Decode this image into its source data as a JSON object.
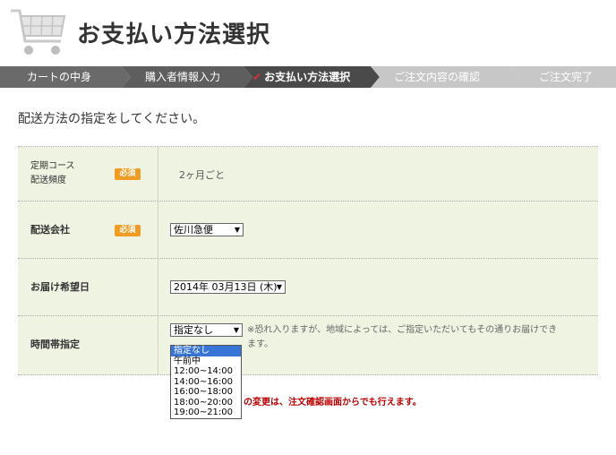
{
  "header": {
    "title": "お支払い方法選択",
    "cart_icon": "shopping-cart-icon"
  },
  "steps": [
    {
      "label": "カートの中身",
      "state": "done"
    },
    {
      "label": "購入者情報入力",
      "state": "done"
    },
    {
      "label": "お支払い方法選択",
      "state": "current"
    },
    {
      "label": "ご注文内容の確認",
      "state": "todo"
    },
    {
      "label": "ご注文完了",
      "state": "todo"
    }
  ],
  "colors": {
    "step_done": "#6a6a6a",
    "step_current": "#4a4a4a",
    "step_todo": "#c7c7c7",
    "row_bg": "#eff3e2",
    "badge": "#f09b21",
    "highlight": "#3875d7",
    "red_note": "#bb0000"
  },
  "instruction": "配送方法の指定をしてください。",
  "form": {
    "required_badge": "必須",
    "course": {
      "label_line1": "定期コース",
      "label_line2": "配送頻度",
      "value": "2ヶ月ごと"
    },
    "carrier": {
      "label": "配送会社",
      "selected": "佐川急便"
    },
    "delivery_date": {
      "label": "お届け希望日",
      "selected": "2014年 03月13日 (木)"
    },
    "time_slot": {
      "label": "時間帯指定",
      "selected": "指定なし",
      "note_line1": "※恐れ入りますが、地域によっては、ご指定いただいてもその通りお届けでき",
      "note_line2": "ます。",
      "options": [
        "指定なし",
        "午前中",
        "12:00~14:00",
        "14:00~16:00",
        "16:00~18:00",
        "18:00~20:00",
        "19:00~21:00"
      ]
    }
  },
  "footer_note": "の変更は、注文確認画面からでも行えます。"
}
